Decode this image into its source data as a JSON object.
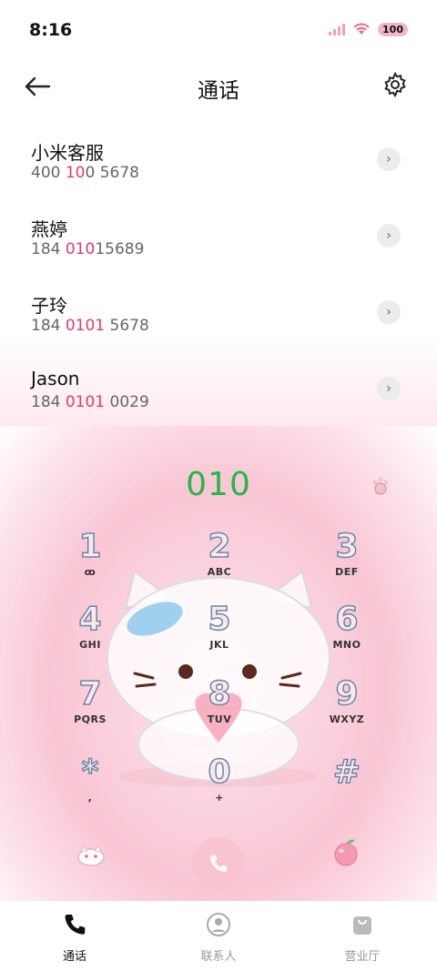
{
  "status_bar": {
    "time": "8:16",
    "battery": "100"
  },
  "header": {
    "title": "通话"
  },
  "suggestions": [
    {
      "name": "小米客服",
      "number_parts": [
        "400 ",
        "10",
        "0 5678"
      ]
    },
    {
      "name": "燕婷",
      "number_parts": [
        "184 ",
        "010",
        "15689"
      ]
    },
    {
      "name": "子玲",
      "number_parts": [
        "184 ",
        "0101",
        " 5678"
      ]
    },
    {
      "name": "Jason",
      "number_parts": [
        "184 ",
        "0101",
        " 0029"
      ]
    }
  ],
  "dialer": {
    "input": "010",
    "keys": [
      {
        "digit": "1",
        "letters": "ꝏ"
      },
      {
        "digit": "2",
        "letters": "ABC"
      },
      {
        "digit": "3",
        "letters": "DEF"
      },
      {
        "digit": "4",
        "letters": "GHI"
      },
      {
        "digit": "5",
        "letters": "JKL"
      },
      {
        "digit": "6",
        "letters": "MNO"
      },
      {
        "digit": "7",
        "letters": "PQRS"
      },
      {
        "digit": "8",
        "letters": "TUV"
      },
      {
        "digit": "9",
        "letters": "WXYZ"
      },
      {
        "digit": "*",
        "letters": ","
      },
      {
        "digit": "0",
        "letters": "+"
      },
      {
        "digit": "#",
        "letters": ""
      }
    ]
  },
  "bottom_nav": {
    "tabs": [
      {
        "label": "通话",
        "icon": "phone-icon"
      },
      {
        "label": "联系人",
        "icon": "contacts-icon"
      },
      {
        "label": "营业厅",
        "icon": "service-hall-icon"
      }
    ]
  },
  "colors": {
    "accent_pink": "#e23b6a",
    "digits_green": "#25b847"
  }
}
